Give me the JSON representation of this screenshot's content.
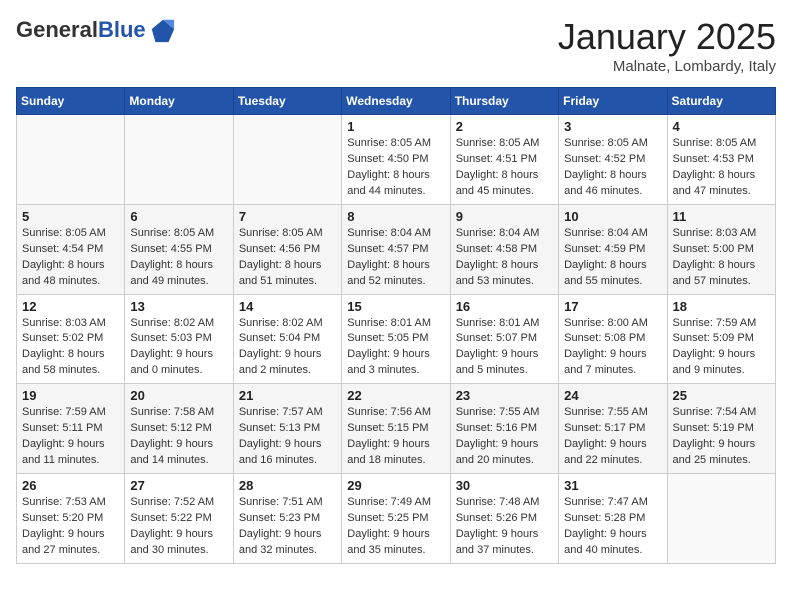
{
  "header": {
    "logo_general": "General",
    "logo_blue": "Blue",
    "month": "January 2025",
    "location": "Malnate, Lombardy, Italy"
  },
  "days_of_week": [
    "Sunday",
    "Monday",
    "Tuesday",
    "Wednesday",
    "Thursday",
    "Friday",
    "Saturday"
  ],
  "weeks": [
    [
      {
        "day": "",
        "info": ""
      },
      {
        "day": "",
        "info": ""
      },
      {
        "day": "",
        "info": ""
      },
      {
        "day": "1",
        "info": "Sunrise: 8:05 AM\nSunset: 4:50 PM\nDaylight: 8 hours\nand 44 minutes."
      },
      {
        "day": "2",
        "info": "Sunrise: 8:05 AM\nSunset: 4:51 PM\nDaylight: 8 hours\nand 45 minutes."
      },
      {
        "day": "3",
        "info": "Sunrise: 8:05 AM\nSunset: 4:52 PM\nDaylight: 8 hours\nand 46 minutes."
      },
      {
        "day": "4",
        "info": "Sunrise: 8:05 AM\nSunset: 4:53 PM\nDaylight: 8 hours\nand 47 minutes."
      }
    ],
    [
      {
        "day": "5",
        "info": "Sunrise: 8:05 AM\nSunset: 4:54 PM\nDaylight: 8 hours\nand 48 minutes."
      },
      {
        "day": "6",
        "info": "Sunrise: 8:05 AM\nSunset: 4:55 PM\nDaylight: 8 hours\nand 49 minutes."
      },
      {
        "day": "7",
        "info": "Sunrise: 8:05 AM\nSunset: 4:56 PM\nDaylight: 8 hours\nand 51 minutes."
      },
      {
        "day": "8",
        "info": "Sunrise: 8:04 AM\nSunset: 4:57 PM\nDaylight: 8 hours\nand 52 minutes."
      },
      {
        "day": "9",
        "info": "Sunrise: 8:04 AM\nSunset: 4:58 PM\nDaylight: 8 hours\nand 53 minutes."
      },
      {
        "day": "10",
        "info": "Sunrise: 8:04 AM\nSunset: 4:59 PM\nDaylight: 8 hours\nand 55 minutes."
      },
      {
        "day": "11",
        "info": "Sunrise: 8:03 AM\nSunset: 5:00 PM\nDaylight: 8 hours\nand 57 minutes."
      }
    ],
    [
      {
        "day": "12",
        "info": "Sunrise: 8:03 AM\nSunset: 5:02 PM\nDaylight: 8 hours\nand 58 minutes."
      },
      {
        "day": "13",
        "info": "Sunrise: 8:02 AM\nSunset: 5:03 PM\nDaylight: 9 hours\nand 0 minutes."
      },
      {
        "day": "14",
        "info": "Sunrise: 8:02 AM\nSunset: 5:04 PM\nDaylight: 9 hours\nand 2 minutes."
      },
      {
        "day": "15",
        "info": "Sunrise: 8:01 AM\nSunset: 5:05 PM\nDaylight: 9 hours\nand 3 minutes."
      },
      {
        "day": "16",
        "info": "Sunrise: 8:01 AM\nSunset: 5:07 PM\nDaylight: 9 hours\nand 5 minutes."
      },
      {
        "day": "17",
        "info": "Sunrise: 8:00 AM\nSunset: 5:08 PM\nDaylight: 9 hours\nand 7 minutes."
      },
      {
        "day": "18",
        "info": "Sunrise: 7:59 AM\nSunset: 5:09 PM\nDaylight: 9 hours\nand 9 minutes."
      }
    ],
    [
      {
        "day": "19",
        "info": "Sunrise: 7:59 AM\nSunset: 5:11 PM\nDaylight: 9 hours\nand 11 minutes."
      },
      {
        "day": "20",
        "info": "Sunrise: 7:58 AM\nSunset: 5:12 PM\nDaylight: 9 hours\nand 14 minutes."
      },
      {
        "day": "21",
        "info": "Sunrise: 7:57 AM\nSunset: 5:13 PM\nDaylight: 9 hours\nand 16 minutes."
      },
      {
        "day": "22",
        "info": "Sunrise: 7:56 AM\nSunset: 5:15 PM\nDaylight: 9 hours\nand 18 minutes."
      },
      {
        "day": "23",
        "info": "Sunrise: 7:55 AM\nSunset: 5:16 PM\nDaylight: 9 hours\nand 20 minutes."
      },
      {
        "day": "24",
        "info": "Sunrise: 7:55 AM\nSunset: 5:17 PM\nDaylight: 9 hours\nand 22 minutes."
      },
      {
        "day": "25",
        "info": "Sunrise: 7:54 AM\nSunset: 5:19 PM\nDaylight: 9 hours\nand 25 minutes."
      }
    ],
    [
      {
        "day": "26",
        "info": "Sunrise: 7:53 AM\nSunset: 5:20 PM\nDaylight: 9 hours\nand 27 minutes."
      },
      {
        "day": "27",
        "info": "Sunrise: 7:52 AM\nSunset: 5:22 PM\nDaylight: 9 hours\nand 30 minutes."
      },
      {
        "day": "28",
        "info": "Sunrise: 7:51 AM\nSunset: 5:23 PM\nDaylight: 9 hours\nand 32 minutes."
      },
      {
        "day": "29",
        "info": "Sunrise: 7:49 AM\nSunset: 5:25 PM\nDaylight: 9 hours\nand 35 minutes."
      },
      {
        "day": "30",
        "info": "Sunrise: 7:48 AM\nSunset: 5:26 PM\nDaylight: 9 hours\nand 37 minutes."
      },
      {
        "day": "31",
        "info": "Sunrise: 7:47 AM\nSunset: 5:28 PM\nDaylight: 9 hours\nand 40 minutes."
      },
      {
        "day": "",
        "info": ""
      }
    ]
  ]
}
